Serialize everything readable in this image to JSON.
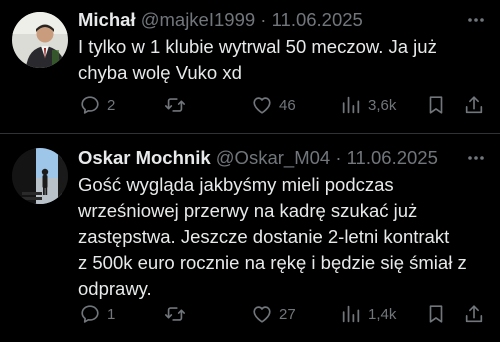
{
  "tweets": [
    {
      "display_name": "Michał",
      "handle": "@majkeI1999",
      "separator": "·",
      "date": "11.06.2025",
      "text": "I tylko w 1 klubie wytrwal 50 meczow. Ja już\nchyba wolę Vuko xd",
      "actions": {
        "replies": "2",
        "reposts": "",
        "likes": "46",
        "views": "3,6k"
      }
    },
    {
      "display_name": "Oskar Mochnik",
      "handle": "@Oskar_M04",
      "separator": "·",
      "date": "11.06.2025",
      "text": "Gość wygląda jakbyśmy mieli podczas\nwrześniowej przerwy na kadrę szukać już\nzastępstwa. Jeszcze dostanie 2-letni kontrakt\nz 500k euro rocznie na rękę i będzie się śmiał z\nodprawy.",
      "actions": {
        "replies": "1",
        "reposts": "",
        "likes": "27",
        "views": "1,4k"
      }
    }
  ],
  "colors": {
    "background": "#000000",
    "text_primary": "#e7e9ea",
    "text_secondary": "#71767b",
    "divider": "#2f3336"
  }
}
